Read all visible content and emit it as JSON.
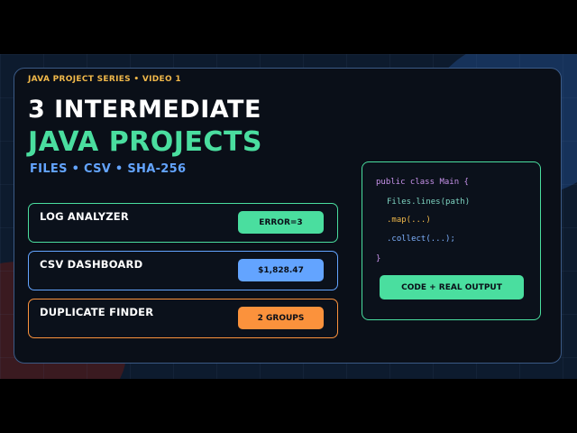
{
  "header": {
    "series": "JAVA PROJECT SERIES • VIDEO 1",
    "title_line1": "3 INTERMEDIATE",
    "title_line2": "JAVA PROJECTS",
    "subtitle": "FILES • CSV • SHA-256"
  },
  "projects": [
    {
      "label": "LOG ANALYZER",
      "badge": "ERROR=3",
      "color": "#4ade9f"
    },
    {
      "label": "CSV DASHBOARD",
      "badge": "$1,828.47",
      "color": "#63a4ff"
    },
    {
      "label": "DUPLICATE FINDER",
      "badge": "2 GROUPS",
      "color": "#fb923c"
    }
  ],
  "code": {
    "lines": [
      "public class Main {",
      "Files.lines(path)",
      ".map(...)",
      ".collect(...);",
      "}"
    ],
    "button": "CODE + REAL OUTPUT"
  },
  "colors": {
    "accent_green": "#4ade9f",
    "accent_blue": "#63a4ff",
    "accent_orange": "#fb923c",
    "accent_yellow": "#f0b84a",
    "code_purple": "#c792ea",
    "code_teal": "#7dd3c0"
  }
}
